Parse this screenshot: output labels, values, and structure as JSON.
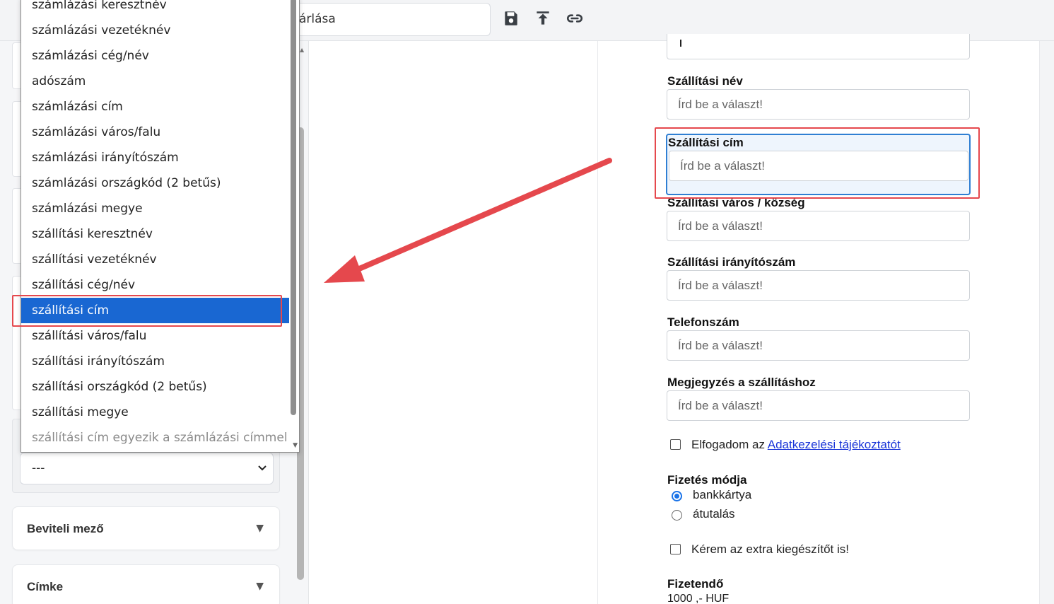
{
  "toolbar": {
    "title_value": "árlása",
    "icons": [
      "save-icon",
      "upload-icon",
      "link-icon"
    ]
  },
  "left_panel": {
    "select_value": "---",
    "accordions": [
      {
        "label": "Beviteli mező",
        "caret": "▼"
      },
      {
        "label": "Címke",
        "caret": "▼"
      }
    ]
  },
  "dropdown": {
    "items": [
      "számlázási keresztnév",
      "számlázási vezetéknév",
      "számlázási cég/név",
      "adószám",
      "számlázási cím",
      "számlázási város/falu",
      "számlázási irányítószám",
      "számlázási országkód (2 betűs)",
      "számlázási megye",
      "szállítási keresztnév",
      "szállítási vezetéknév",
      "szállítási cég/név",
      "szállítási cím",
      "szállítási város/falu",
      "szállítási irányítószám",
      "szállítási országkód (2 betűs)",
      "szállítási megye",
      "szállítási cím egyezik a számlázási címmel"
    ],
    "selected_index": 12
  },
  "form": {
    "placeholder": "Írd be a választ!",
    "fields": [
      {
        "label": "Szállítási név"
      },
      {
        "label": "Szállítási cím"
      },
      {
        "label": "Szállítási város / község"
      },
      {
        "label": "Szállítási irányítószám"
      },
      {
        "label": "Telefonszám"
      },
      {
        "label": "Megjegyzés a szállításhoz"
      }
    ],
    "privacy": {
      "prefix": "Elfogadom az",
      "link": "Adatkezelési tájékoztatót"
    },
    "payment": {
      "label": "Fizetés módja",
      "options": [
        "bankkártya",
        "átutalás"
      ],
      "selected": "bankkártya"
    },
    "extra_checkbox": "Kérem az extra kiegészítőt is!",
    "total": {
      "label": "Fizetendő",
      "amount": "1000 ,- HUF"
    }
  },
  "colors": {
    "selected_item": "#1967d2",
    "annotation": "#e5484d",
    "field_highlight": "#2f7fd3",
    "link": "#1a35d8"
  }
}
